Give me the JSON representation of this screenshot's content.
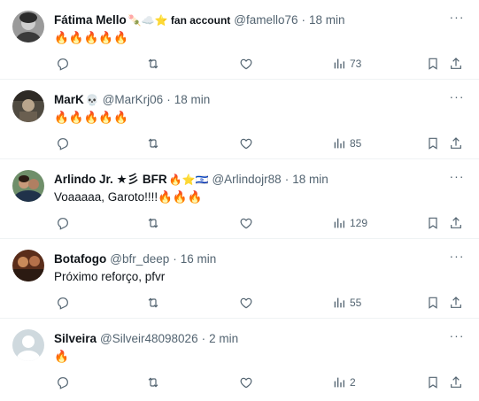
{
  "tweets": [
    {
      "name": "Fátima Mello",
      "name_extra": "🍡☁️⭐ fan account",
      "handle": "@famello76",
      "time": "18 min",
      "text": "🔥🔥🔥🔥🔥",
      "views": "73",
      "avatar_color": "#8a8a8a"
    },
    {
      "name": "MarK",
      "name_extra": "💀",
      "handle": "@MarKrj06",
      "time": "18 min",
      "text": "🔥🔥🔥🔥🔥",
      "views": "85",
      "avatar_color": "#5c5348"
    },
    {
      "name": "Arlindo Jr. ★彡 BFR",
      "name_extra": "🔥⭐🇮🇱",
      "handle": "@Arlindojr88",
      "time": "18 min",
      "text": "Voaaaaa, Garoto!!!!🔥🔥🔥",
      "views": "129",
      "avatar_color": "#3d6b4a"
    },
    {
      "name": "Botafogo",
      "name_extra": "",
      "handle": "@bfr_deep",
      "time": "16 min",
      "text": "Próximo reforço, pfvr",
      "views": "55",
      "avatar_color": "#7a3b22"
    },
    {
      "name": "Silveira",
      "name_extra": "",
      "handle": "@Silveir48098026",
      "time": "2 min",
      "text": "🔥",
      "views": "2",
      "avatar_color": "#cfd9de"
    }
  ],
  "separator": "·",
  "more_label": "···",
  "icons": [
    "reply-icon",
    "retweet-icon",
    "like-icon",
    "views-icon",
    "bookmark-icon",
    "share-icon"
  ],
  "colors": {
    "text": "#0f1419",
    "muted": "#536471",
    "divider": "#eff3f4"
  }
}
